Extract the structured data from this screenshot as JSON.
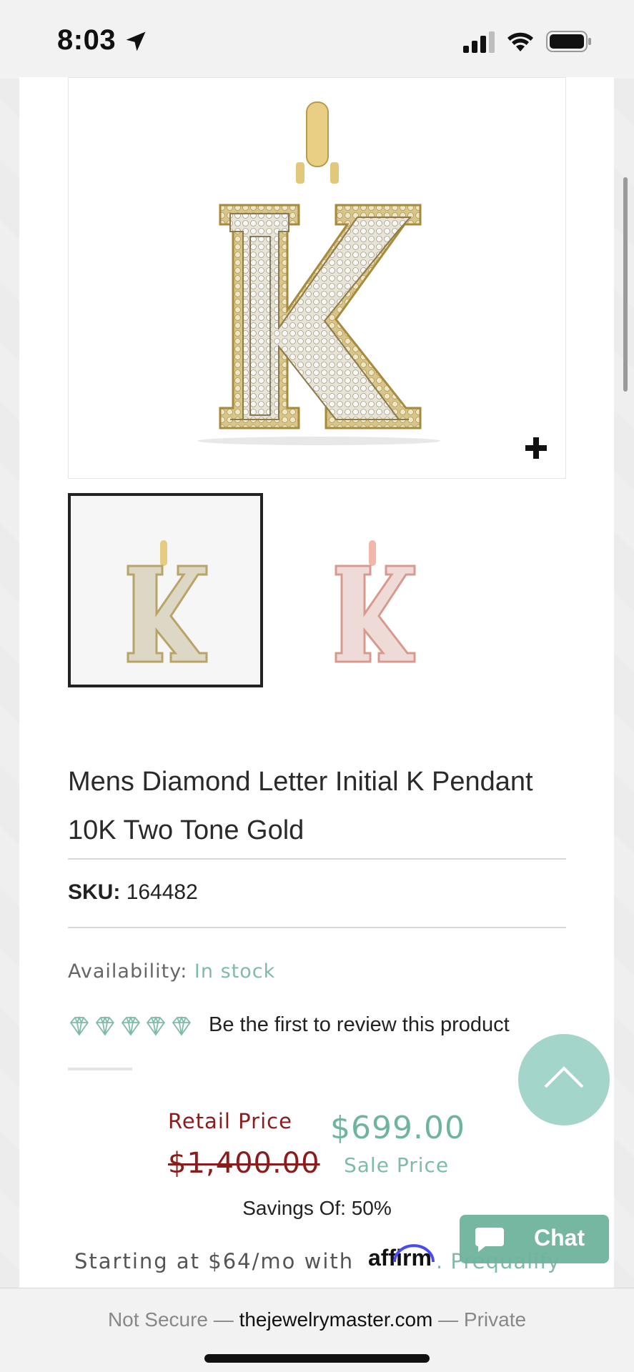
{
  "status_bar": {
    "time": "8:03",
    "icons": [
      "location-arrow-icon",
      "cellular-signal-icon",
      "wifi-icon",
      "battery-icon"
    ]
  },
  "gallery": {
    "main_image": "K letter pendant, yellow gold with diamonds",
    "zoom_icon": "plus-icon",
    "thumbnails": [
      {
        "variant": "yellow gold",
        "selected": true
      },
      {
        "variant": "rose gold",
        "selected": false
      }
    ]
  },
  "product": {
    "title_line1": "Mens Diamond Letter Initial K Pendant",
    "title_line2": "10K Two Tone Gold",
    "sku_label": "SKU:",
    "sku_value": "164482",
    "availability_label": "Availability:",
    "availability_value": "In stock",
    "review_text": "Be the first to review this product"
  },
  "pricing": {
    "retail_label": "Retail Price",
    "retail_price": "$1,400.00",
    "sale_price": "$699.00",
    "sale_label": "Sale Price",
    "savings": "Savings Of: 50%",
    "financing_text": "Starting at $64/mo with",
    "financing_brand": "affirm",
    "prequalify": ". Prequalify"
  },
  "chat": {
    "label": "Chat"
  },
  "browser": {
    "prefix": "Not Secure — ",
    "domain": "thejewelrymaster.com",
    "suffix": " — Private"
  },
  "colors": {
    "accent_green": "#7fbca6",
    "retail_red": "#8b1c1c",
    "scroll_button": "#a4d5ca"
  }
}
